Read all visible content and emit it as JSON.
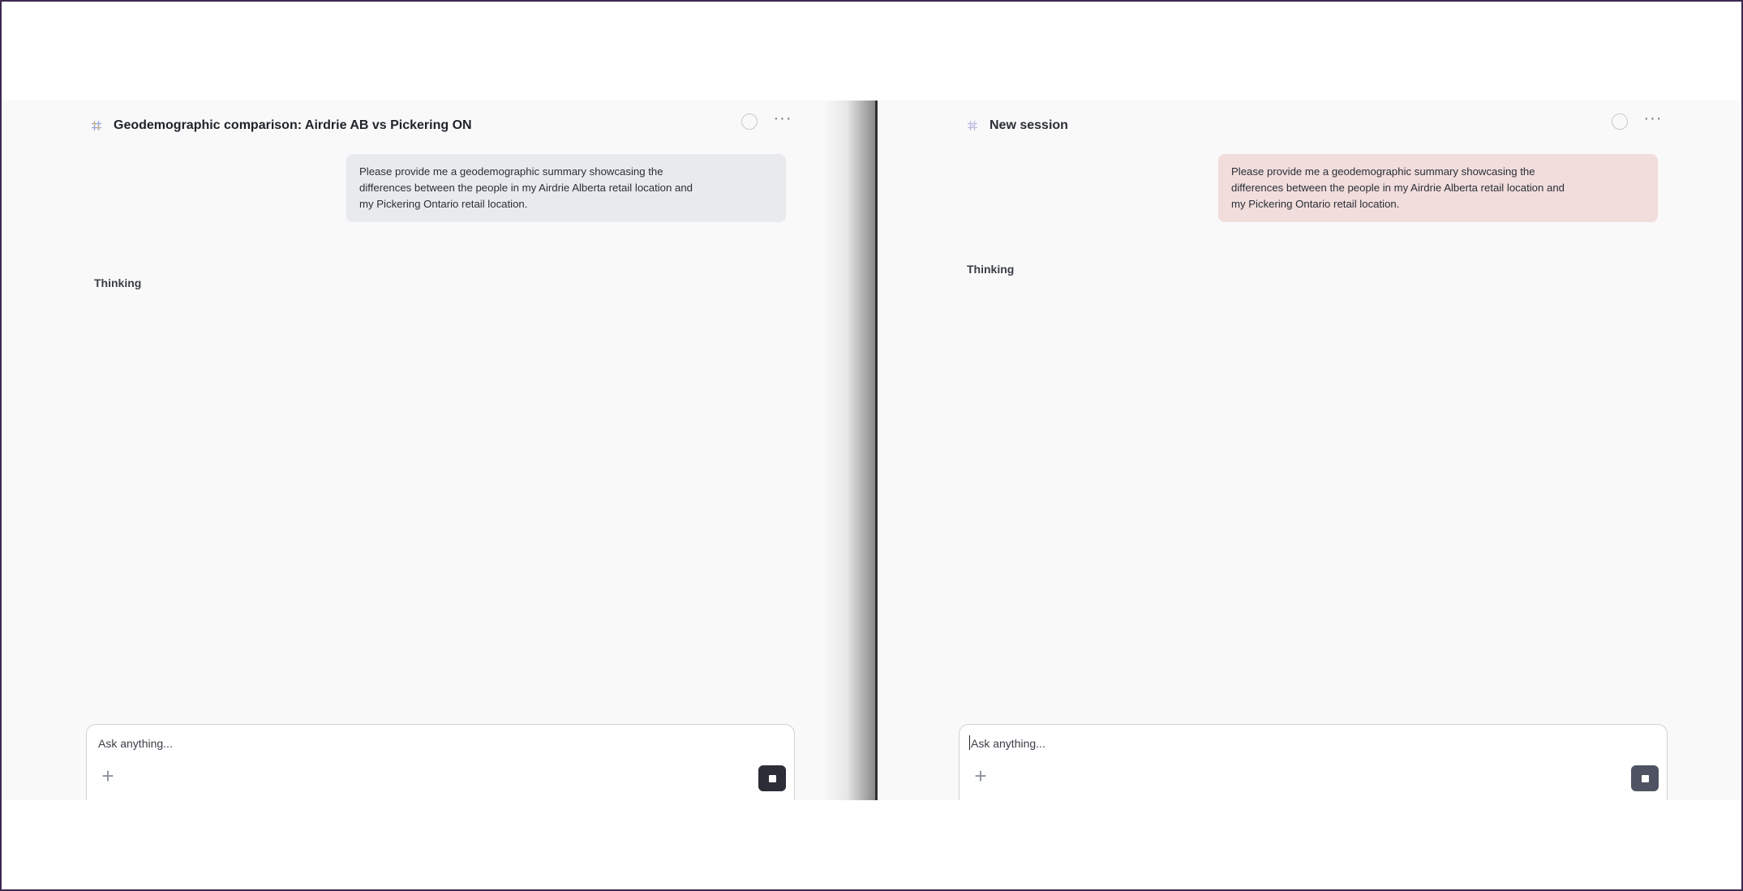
{
  "sessions": [
    {
      "title": "Geodemographic comparison: Airdrie AB vs Pickering ON",
      "title_icon": "grid-hash-icon",
      "status_icon": "circle-icon",
      "more_label": "···",
      "message": "Please provide me a geodemographic summary showcasing the differences between the people in my Airdrie Alberta retail location and my Pickering Ontario retail location.",
      "message_lines": [
        "Please provide me a geodemographic summary showcasing the",
        "differences between the people in my Airdrie Alberta retail location and",
        "my Pickering Ontario retail location."
      ],
      "message_color": "#e8eaed",
      "status_text": "Thinking",
      "composer": {
        "placeholder": "Ask anything...",
        "value": "",
        "add_label": "+",
        "stop_icon": "stop-square-icon"
      }
    },
    {
      "title": "New session",
      "title_icon": "grid-hash-icon",
      "status_icon": "circle-icon",
      "more_label": "···",
      "message": "Please provide me a geodemographic summary showcasing the differences between the people in my Airdrie Alberta retail location and my Pickering Ontario retail location.",
      "message_lines": [
        "Please provide me a geodemographic summary showcasing the",
        "differences between the people in my Airdrie Alberta retail location and",
        "my Pickering Ontario retail location."
      ],
      "message_color": "#f1dddc",
      "status_text": "Thinking",
      "composer": {
        "placeholder": "Ask anything...",
        "value": "",
        "add_label": "+",
        "stop_icon": "stop-square-icon"
      }
    }
  ],
  "colors": {
    "frame_border": "#3d2a52",
    "panel_background": "#f9f9fa",
    "divider": "#2f2f33",
    "stop_button": "#2b2e36"
  }
}
